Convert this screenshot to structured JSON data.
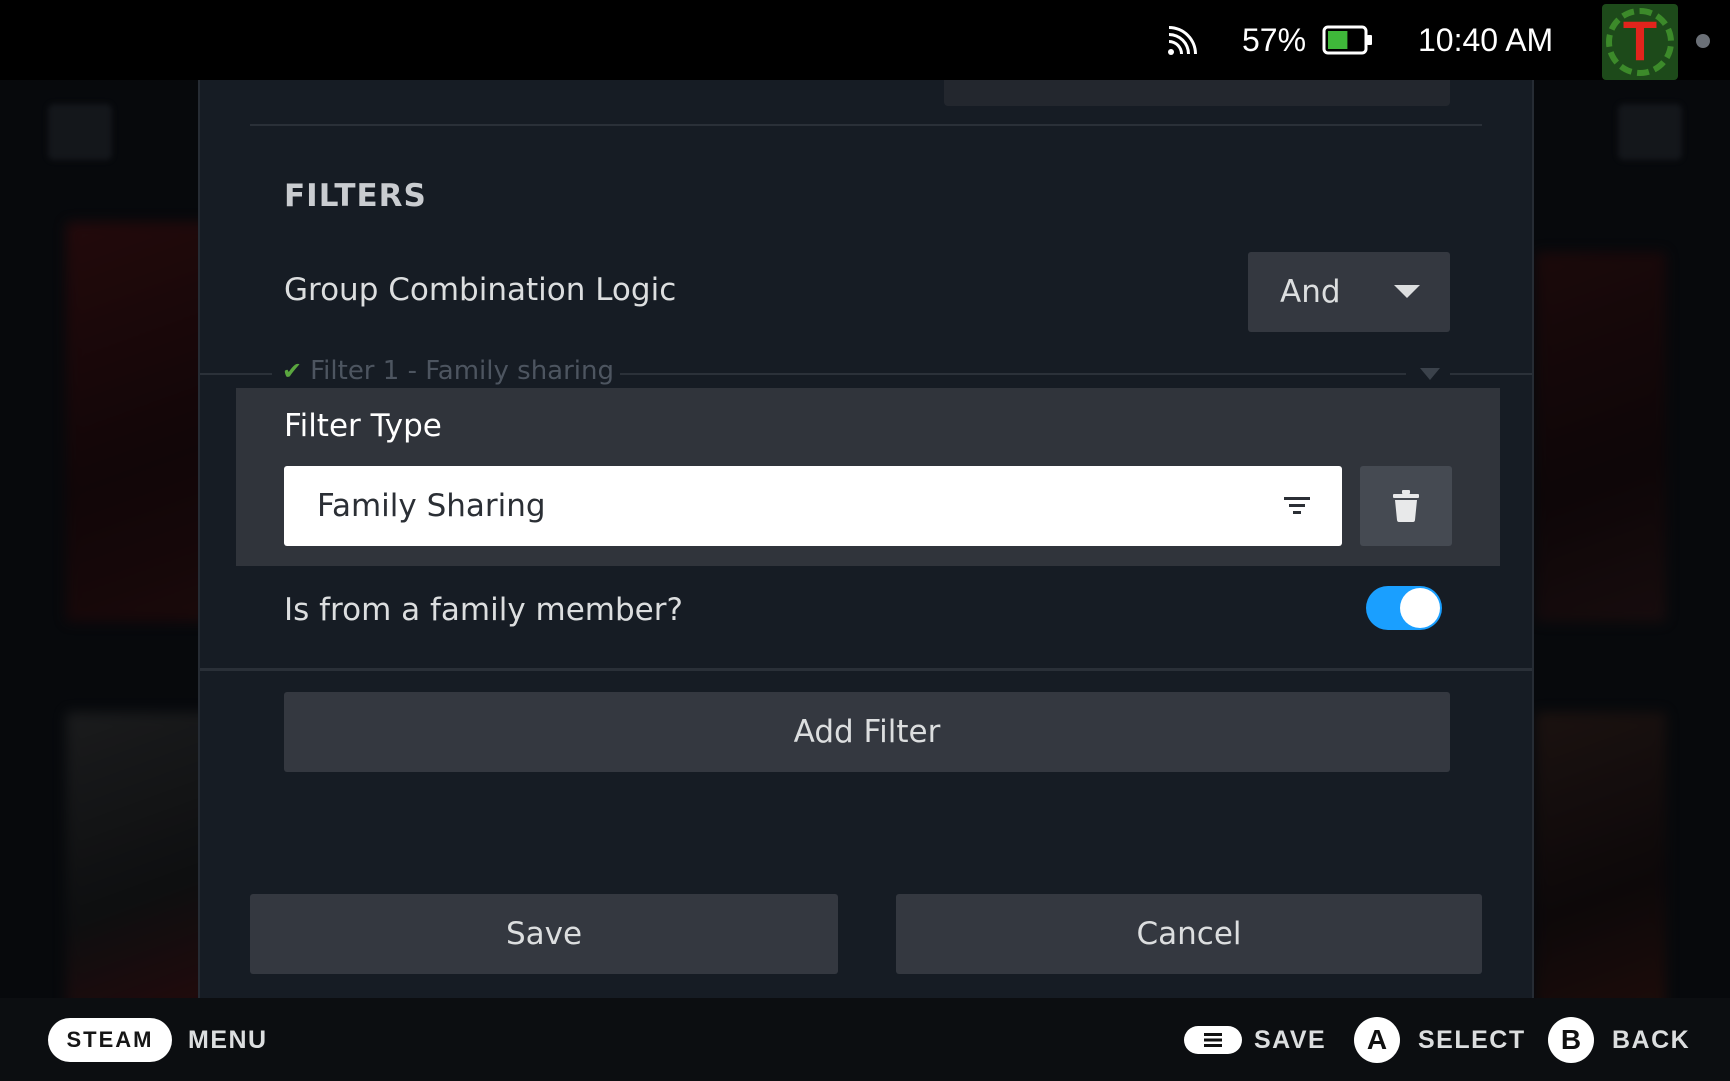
{
  "status_bar": {
    "battery_percent": "57%",
    "battery_level": 0.57,
    "time": "10:40 AM",
    "avatar_letter": "T",
    "icons": [
      "cast-icon",
      "battery-icon"
    ]
  },
  "dialog": {
    "section_title": "FILTERS",
    "group_logic": {
      "label": "Group Combination Logic",
      "value": "And"
    },
    "filter_group": {
      "title": "Filter 1 - Family sharing",
      "filter_type_label": "Filter Type",
      "filter_type_value": "Family Sharing"
    },
    "family_toggle": {
      "label": "Is from a family member?",
      "checked": true
    },
    "add_filter_label": "Add Filter",
    "save_label": "Save",
    "cancel_label": "Cancel"
  },
  "footer": {
    "steam_label": "STEAM",
    "menu_label": "MENU",
    "save_label": "SAVE",
    "a_glyph": "A",
    "select_label": "SELECT",
    "b_glyph": "B",
    "back_label": "BACK"
  },
  "colors": {
    "accent": "#1a9fff",
    "check": "#5aa63f",
    "dialog_bg": "#161c24",
    "panel_bg": "#30343b",
    "button_bg": "#343840"
  }
}
